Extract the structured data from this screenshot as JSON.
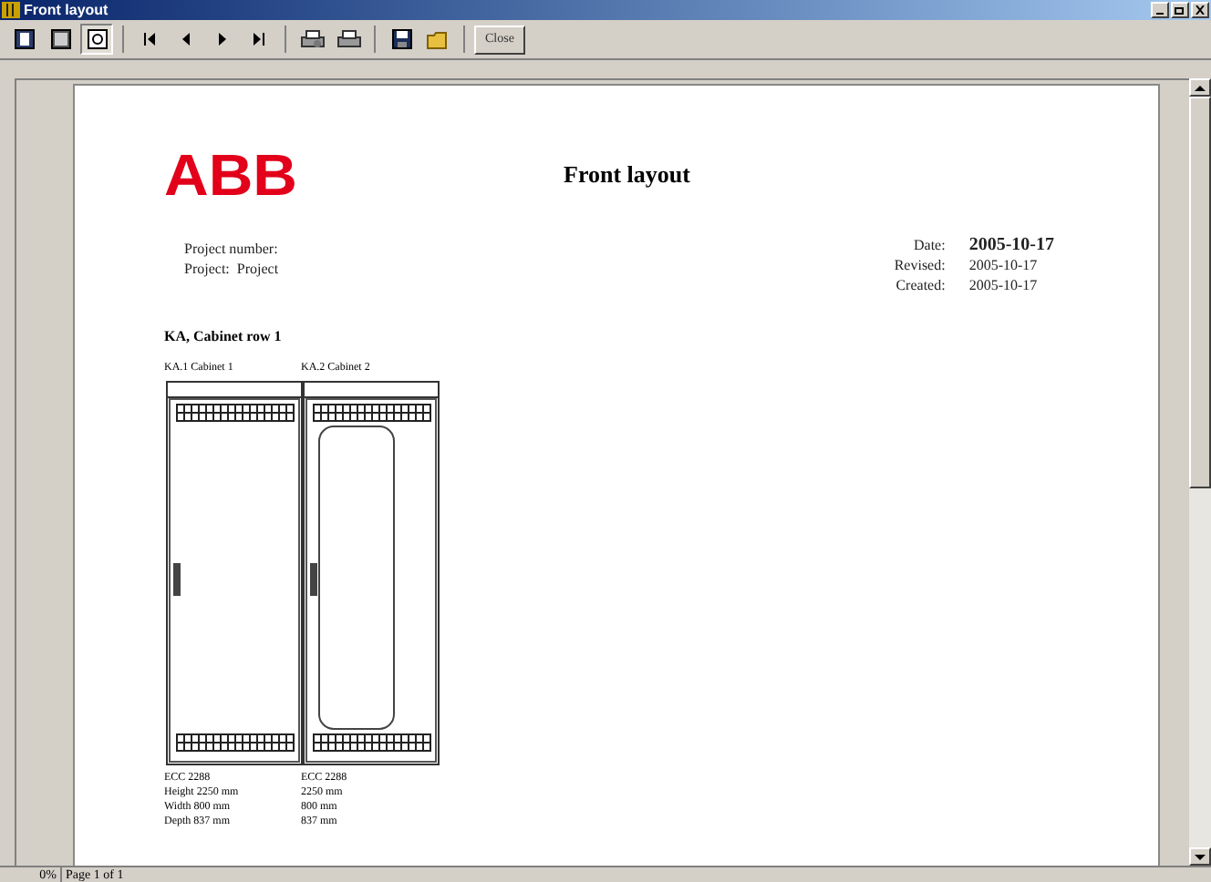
{
  "window": {
    "title": "Front layout"
  },
  "toolbar": {
    "close_label": "Close"
  },
  "report": {
    "title": "Front layout",
    "logo": "ABB",
    "left_fields": [
      {
        "label": "Project number:"
      },
      {
        "label": "Project:",
        "value": "Project"
      }
    ],
    "right_fields": [
      {
        "label": "Date:",
        "value": "2005-10-17",
        "bold": true
      },
      {
        "label": "Revised:",
        "value": "2005-10-17",
        "bold": false
      },
      {
        "label": "Created:",
        "value": "2005-10-17",
        "bold": false
      }
    ],
    "section": "KA, Cabinet row 1",
    "cabinets": [
      {
        "label": "KA.1 Cabinet 1",
        "kind": "door",
        "specs": [
          "ECC 2288",
          "Height 2250 mm",
          "Width 800 mm",
          "Depth 837 mm"
        ]
      },
      {
        "label": "KA.2 Cabinet 2",
        "kind": "glass",
        "specs": [
          "ECC 2288",
          "2250 mm",
          "800 mm",
          "837 mm"
        ]
      }
    ]
  },
  "status_bar": {
    "zoom": "0%",
    "page": "Page 1 of 1"
  }
}
